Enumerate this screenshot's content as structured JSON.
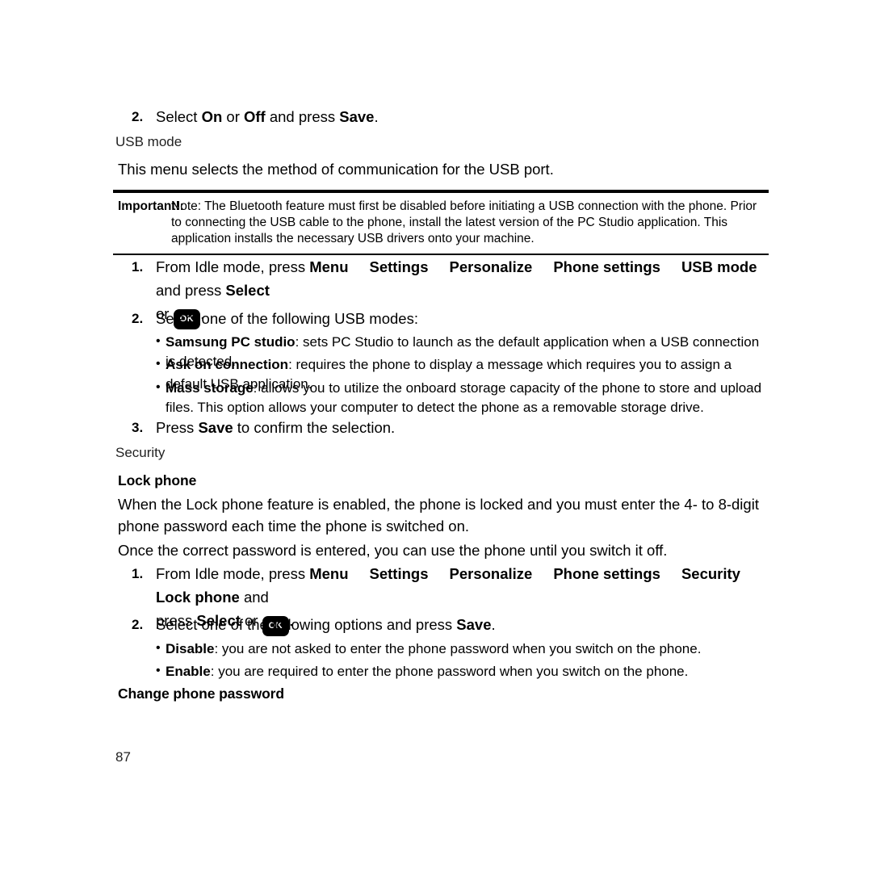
{
  "page": {
    "folio": "87"
  },
  "top_step": {
    "num": "2.",
    "pre": "Select ",
    "b1": "On",
    "mid1": " or ",
    "b2": "Off",
    "mid2": " and press ",
    "b3": "Save",
    "end": "."
  },
  "usb_section": {
    "label": "USB mode",
    "intro": "This menu selects the method of communication for the USB port."
  },
  "note": {
    "label": "Important!:",
    "body": "Note: The Bluetooth feature must first be disabled before initiating a USB connection with the phone. Prior to connecting the USB cable to the phone, install the latest version of the PC Studio application. This application installs the necessary USB drivers onto your machine."
  },
  "usb_steps": {
    "step1": {
      "num": "1.",
      "lead": "From Idle mode, press ",
      "crumbs": [
        "Menu",
        "Settings",
        "Personalize",
        "Phone settings",
        "USB mode"
      ],
      "after_crumbs": " and press ",
      "select_label": "Select",
      "or_text": "or ",
      "key_label": "OK",
      "period": "."
    },
    "step2": {
      "num": "2.",
      "text": "Select one of the following USB modes:"
    },
    "modes": [
      {
        "bullet": "•",
        "name": "Samsung PC studio",
        "desc": ": sets PC Studio to launch as the default application when a USB connection is detected."
      },
      {
        "bullet": "•",
        "name": "Ask on connection",
        "desc": ": requires the phone to display a message which requires you to assign a default USB application."
      },
      {
        "bullet": "•",
        "name": "Mass storage",
        "desc": ": allows you to utilize the onboard storage capacity of the phone to store and upload files. This option allows your computer to detect the phone as a removable storage drive."
      }
    ],
    "step3": {
      "num": "3.",
      "pre": "Press ",
      "bold": "Save",
      "post": " to confirm the selection."
    }
  },
  "security_section": {
    "label": "Security",
    "lock_phone_heading": "Lock phone",
    "para1": "When the Lock phone feature is enabled, the phone is locked and you must enter the 4- to 8-digit phone password each time the phone is switched on.",
    "para2": "Once the correct password is entered, you can use the phone until you switch it off.",
    "step1": {
      "num": "1.",
      "lead": "From Idle mode, press ",
      "crumbs": [
        "Menu",
        "Settings",
        "Personalize",
        "Phone settings",
        "Security",
        "Lock phone"
      ],
      "after_crumbs": " and",
      "press_text": "press ",
      "select_label": "Select",
      "or_text": " or ",
      "key_label": "OK",
      "period": "."
    },
    "step2": {
      "num": "2.",
      "pre": "Select one of the following options and press ",
      "bold": "Save",
      "post": "."
    },
    "options": [
      {
        "bullet": "•",
        "name": "Disable",
        "desc": ": you are not asked to enter the phone password when you switch on the phone."
      },
      {
        "bullet": "•",
        "name": "Enable",
        "desc": ": you are required to enter the phone password when you switch on the phone."
      }
    ],
    "change_password_heading": "Change phone password"
  }
}
